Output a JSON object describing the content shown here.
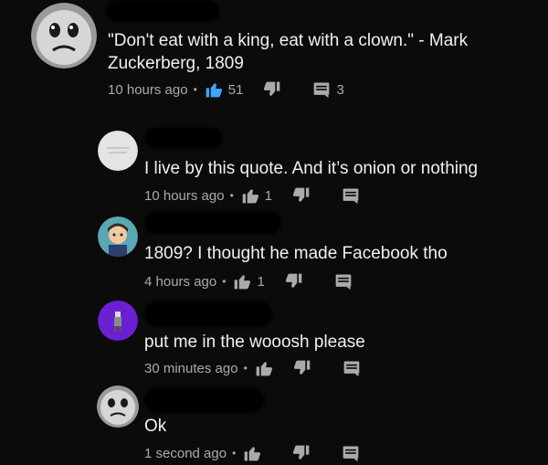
{
  "comments": [
    {
      "text_lines": [
        "\"Don't eat with a king, eat with a clown.\" - Mark",
        "Zuckerberg, 1809"
      ],
      "time": "10 hours ago",
      "likes": "51",
      "replies": "3",
      "avatar": "cartoon-face",
      "liked": true
    },
    {
      "text_lines": [
        "I live by this quote. And it’s onion or nothing"
      ],
      "time": "10 hours ago",
      "likes": "1",
      "replies": "",
      "avatar": "plain-light"
    },
    {
      "text_lines": [
        "1809? I thought he made Facebook tho"
      ],
      "time": "4 hours ago",
      "likes": "1",
      "replies": "",
      "avatar": "cartoon-boy"
    },
    {
      "text_lines": [
        "put me in the wooosh please"
      ],
      "time": "30 minutes ago",
      "likes": "",
      "replies": "",
      "avatar": "purple-figure"
    },
    {
      "text_lines": [
        "Ok"
      ],
      "time": "1 second ago",
      "likes": "",
      "replies": "",
      "avatar": "cartoon-face"
    }
  ],
  "colors": {
    "like_active": "#3ea6ff",
    "meta_text": "#aaaaaa",
    "background": "#0b0b0b"
  },
  "icons": [
    "like-icon",
    "dislike-icon",
    "reply-icon"
  ]
}
